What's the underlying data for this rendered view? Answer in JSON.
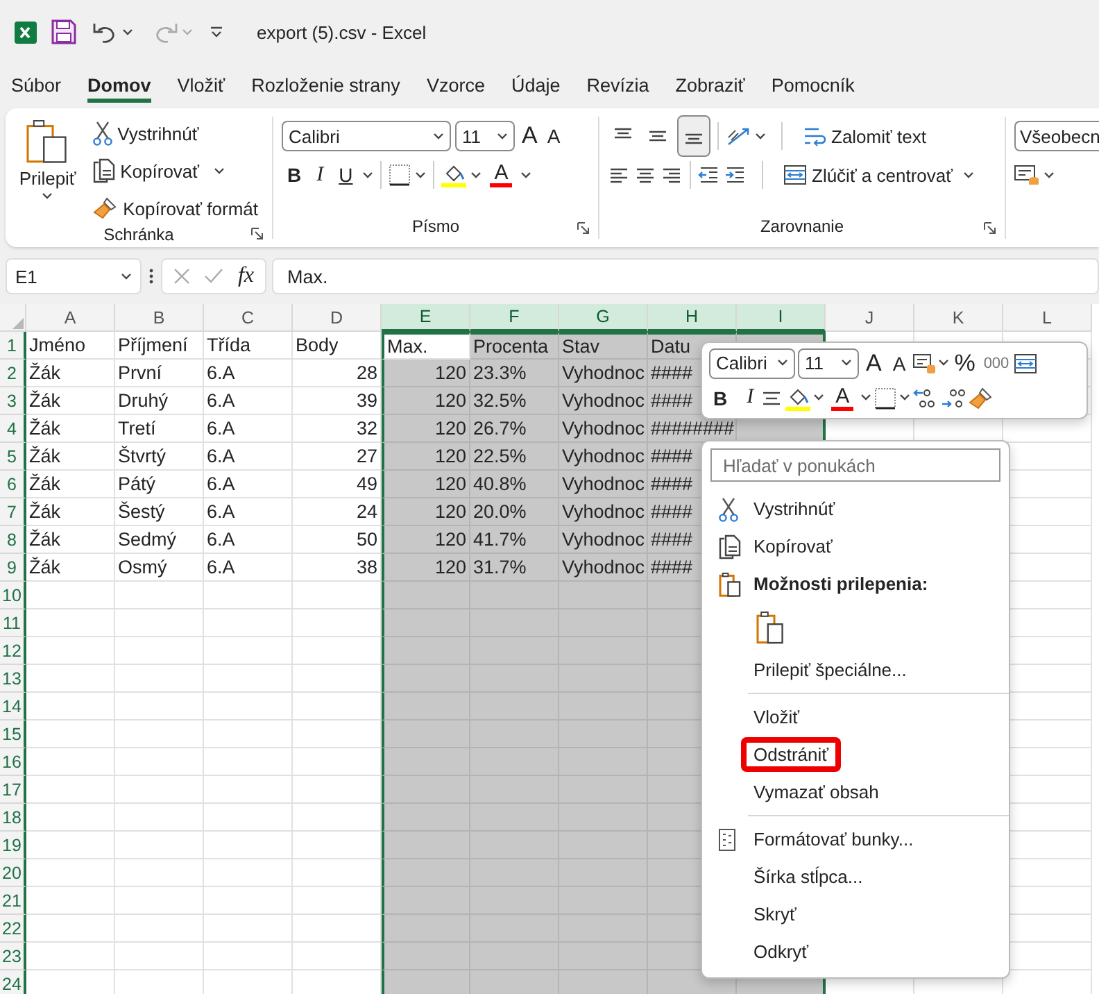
{
  "title_bar": {
    "title": "export (5).csv  -  Excel"
  },
  "menu_tabs": [
    {
      "label": "Súbor",
      "selected": false
    },
    {
      "label": "Domov",
      "selected": true
    },
    {
      "label": "Vložiť",
      "selected": false
    },
    {
      "label": "Rozloženie strany",
      "selected": false
    },
    {
      "label": "Vzorce",
      "selected": false
    },
    {
      "label": "Údaje",
      "selected": false
    },
    {
      "label": "Revízia",
      "selected": false
    },
    {
      "label": "Zobraziť",
      "selected": false
    },
    {
      "label": "Pomocník",
      "selected": false
    }
  ],
  "ribbon": {
    "clipboard": {
      "paste": "Prilepiť",
      "cut": "Vystrihnúť",
      "copy": "Kopírovať",
      "format_painter": "Kopírovať formát",
      "label": "Schránka"
    },
    "font": {
      "font_name": "Calibri",
      "font_size": "11",
      "grow_font": "A",
      "shrink_font": "A",
      "bold": "B",
      "italic": "I",
      "underline": "U",
      "font_color": "A",
      "label": "Písmo"
    },
    "alignment": {
      "vertical": [
        {
          "selected": false
        },
        {
          "selected": false
        },
        {
          "selected": true
        }
      ],
      "wrap_text": "Zalomiť text",
      "merge_center": "Zlúčiť a centrovať",
      "label": "Zarovnanie"
    },
    "number": {
      "format": "Všeobecn"
    }
  },
  "formula_bar": {
    "name_box": "E1",
    "function_label": "fx",
    "value": "Max."
  },
  "sheet": {
    "columns": [
      {
        "label": "A",
        "selected": false
      },
      {
        "label": "B",
        "selected": false
      },
      {
        "label": "C",
        "selected": false
      },
      {
        "label": "D",
        "selected": false
      },
      {
        "label": "E",
        "selected": true
      },
      {
        "label": "F",
        "selected": true
      },
      {
        "label": "G",
        "selected": true
      },
      {
        "label": "H",
        "selected": true
      },
      {
        "label": "I",
        "selected": true
      },
      {
        "label": "J",
        "selected": false
      },
      {
        "label": "K",
        "selected": false
      },
      {
        "label": "L",
        "selected": false
      }
    ],
    "rows": [
      {
        "number": "1",
        "cells": [
          {
            "text": "Jméno",
            "kind": "text"
          },
          {
            "text": "Příjmení",
            "kind": "text"
          },
          {
            "text": "Třída",
            "kind": "text"
          },
          {
            "text": "Body",
            "kind": "text"
          },
          {
            "text": "Max.",
            "kind": "active"
          },
          {
            "text": "Procenta",
            "kind": "text"
          },
          {
            "text": "Stav",
            "kind": "text"
          },
          {
            "text": "Datu",
            "kind": "text"
          }
        ]
      },
      {
        "number": "2",
        "cells": [
          {
            "text": "Žák",
            "kind": "text"
          },
          {
            "text": "První",
            "kind": "text"
          },
          {
            "text": "6.A",
            "kind": "text"
          },
          {
            "text": "28",
            "kind": "number"
          },
          {
            "text": "120",
            "kind": "number"
          },
          {
            "text": "23.3%",
            "kind": "text"
          },
          {
            "text": "Vyhodnoc",
            "kind": "text"
          },
          {
            "text": "####",
            "kind": "text"
          }
        ]
      },
      {
        "number": "3",
        "cells": [
          {
            "text": "Žák",
            "kind": "text"
          },
          {
            "text": "Druhý",
            "kind": "text"
          },
          {
            "text": "6.A",
            "kind": "text"
          },
          {
            "text": "39",
            "kind": "number"
          },
          {
            "text": "120",
            "kind": "number"
          },
          {
            "text": "32.5%",
            "kind": "text"
          },
          {
            "text": "Vyhodnoc",
            "kind": "text"
          },
          {
            "text": "####",
            "kind": "text"
          }
        ]
      },
      {
        "number": "4",
        "cells": [
          {
            "text": "Žák",
            "kind": "text"
          },
          {
            "text": "Tretí",
            "kind": "text"
          },
          {
            "text": "6.A",
            "kind": "text"
          },
          {
            "text": "32",
            "kind": "number"
          },
          {
            "text": "120",
            "kind": "number"
          },
          {
            "text": "26.7%",
            "kind": "text"
          },
          {
            "text": "Vyhodnoc",
            "kind": "text"
          },
          {
            "text": "########",
            "kind": "text"
          }
        ]
      },
      {
        "number": "5",
        "cells": [
          {
            "text": "Žák",
            "kind": "text"
          },
          {
            "text": "Štvrtý",
            "kind": "text"
          },
          {
            "text": "6.A",
            "kind": "text"
          },
          {
            "text": "27",
            "kind": "number"
          },
          {
            "text": "120",
            "kind": "number"
          },
          {
            "text": "22.5%",
            "kind": "text"
          },
          {
            "text": "Vyhodnoc",
            "kind": "text"
          },
          {
            "text": "####",
            "kind": "text"
          }
        ]
      },
      {
        "number": "6",
        "cells": [
          {
            "text": "Žák",
            "kind": "text"
          },
          {
            "text": "Pátý",
            "kind": "text"
          },
          {
            "text": "6.A",
            "kind": "text"
          },
          {
            "text": "49",
            "kind": "number"
          },
          {
            "text": "120",
            "kind": "number"
          },
          {
            "text": "40.8%",
            "kind": "text"
          },
          {
            "text": "Vyhodnoc",
            "kind": "text"
          },
          {
            "text": "####",
            "kind": "text"
          }
        ]
      },
      {
        "number": "7",
        "cells": [
          {
            "text": "Žák",
            "kind": "text"
          },
          {
            "text": "Šestý",
            "kind": "text"
          },
          {
            "text": "6.A",
            "kind": "text"
          },
          {
            "text": "24",
            "kind": "number"
          },
          {
            "text": "120",
            "kind": "number"
          },
          {
            "text": "20.0%",
            "kind": "text"
          },
          {
            "text": "Vyhodnoc",
            "kind": "text"
          },
          {
            "text": "####",
            "kind": "text"
          }
        ]
      },
      {
        "number": "8",
        "cells": [
          {
            "text": "Žák",
            "kind": "text"
          },
          {
            "text": "Sedmý",
            "kind": "text"
          },
          {
            "text": "6.A",
            "kind": "text"
          },
          {
            "text": "50",
            "kind": "number"
          },
          {
            "text": "120",
            "kind": "number"
          },
          {
            "text": "41.7%",
            "kind": "text"
          },
          {
            "text": "Vyhodnoc",
            "kind": "text"
          },
          {
            "text": "####",
            "kind": "text"
          }
        ]
      },
      {
        "number": "9",
        "cells": [
          {
            "text": "Žák",
            "kind": "text"
          },
          {
            "text": "Osmý",
            "kind": "text"
          },
          {
            "text": "6.A",
            "kind": "text"
          },
          {
            "text": "38",
            "kind": "number"
          },
          {
            "text": "120",
            "kind": "number"
          },
          {
            "text": "31.7%",
            "kind": "text"
          },
          {
            "text": "Vyhodnoc",
            "kind": "text"
          },
          {
            "text": "####",
            "kind": "text"
          }
        ]
      }
    ],
    "empty_rows": [
      "10",
      "11",
      "12",
      "13",
      "14",
      "15",
      "16",
      "17",
      "18",
      "19",
      "20",
      "21",
      "22",
      "23",
      "24"
    ]
  },
  "mini_toolbar": {
    "font_name": "Calibri",
    "font_size": "11",
    "grow_font": "A",
    "shrink_font": "A",
    "percent": "%",
    "thousands": "000",
    "bold": "B",
    "italic": "I",
    "font_color": "A"
  },
  "context_menu": {
    "search": {
      "placeholder": "Hľadať v ponukách"
    },
    "items": [
      {
        "kind": "cut",
        "label": "Vystrihnúť",
        "highlighted": false
      },
      {
        "kind": "copy",
        "label": "Kopírovať",
        "highlighted": false
      },
      {
        "kind": "paste_heading",
        "label": "Možnosti prilepenia:",
        "highlighted": false
      },
      {
        "kind": "paste_option"
      },
      {
        "kind": "item",
        "label": "Prilepiť špeciálne...",
        "highlighted": false
      },
      {
        "kind": "separator"
      },
      {
        "kind": "item",
        "label": "Vložiť",
        "highlighted": false
      },
      {
        "kind": "item",
        "label": "Odstrániť",
        "highlighted": true
      },
      {
        "kind": "item",
        "label": "Vymazať obsah",
        "highlighted": false
      },
      {
        "kind": "separator"
      },
      {
        "kind": "format_cells",
        "label": "Formátovať bunky...",
        "highlighted": false
      },
      {
        "kind": "item",
        "label": "Šírka stĺpca...",
        "highlighted": false
      },
      {
        "kind": "item",
        "label": "Skryť",
        "highlighted": false
      },
      {
        "kind": "item",
        "label": "Odkryť",
        "highlighted": false
      }
    ]
  }
}
